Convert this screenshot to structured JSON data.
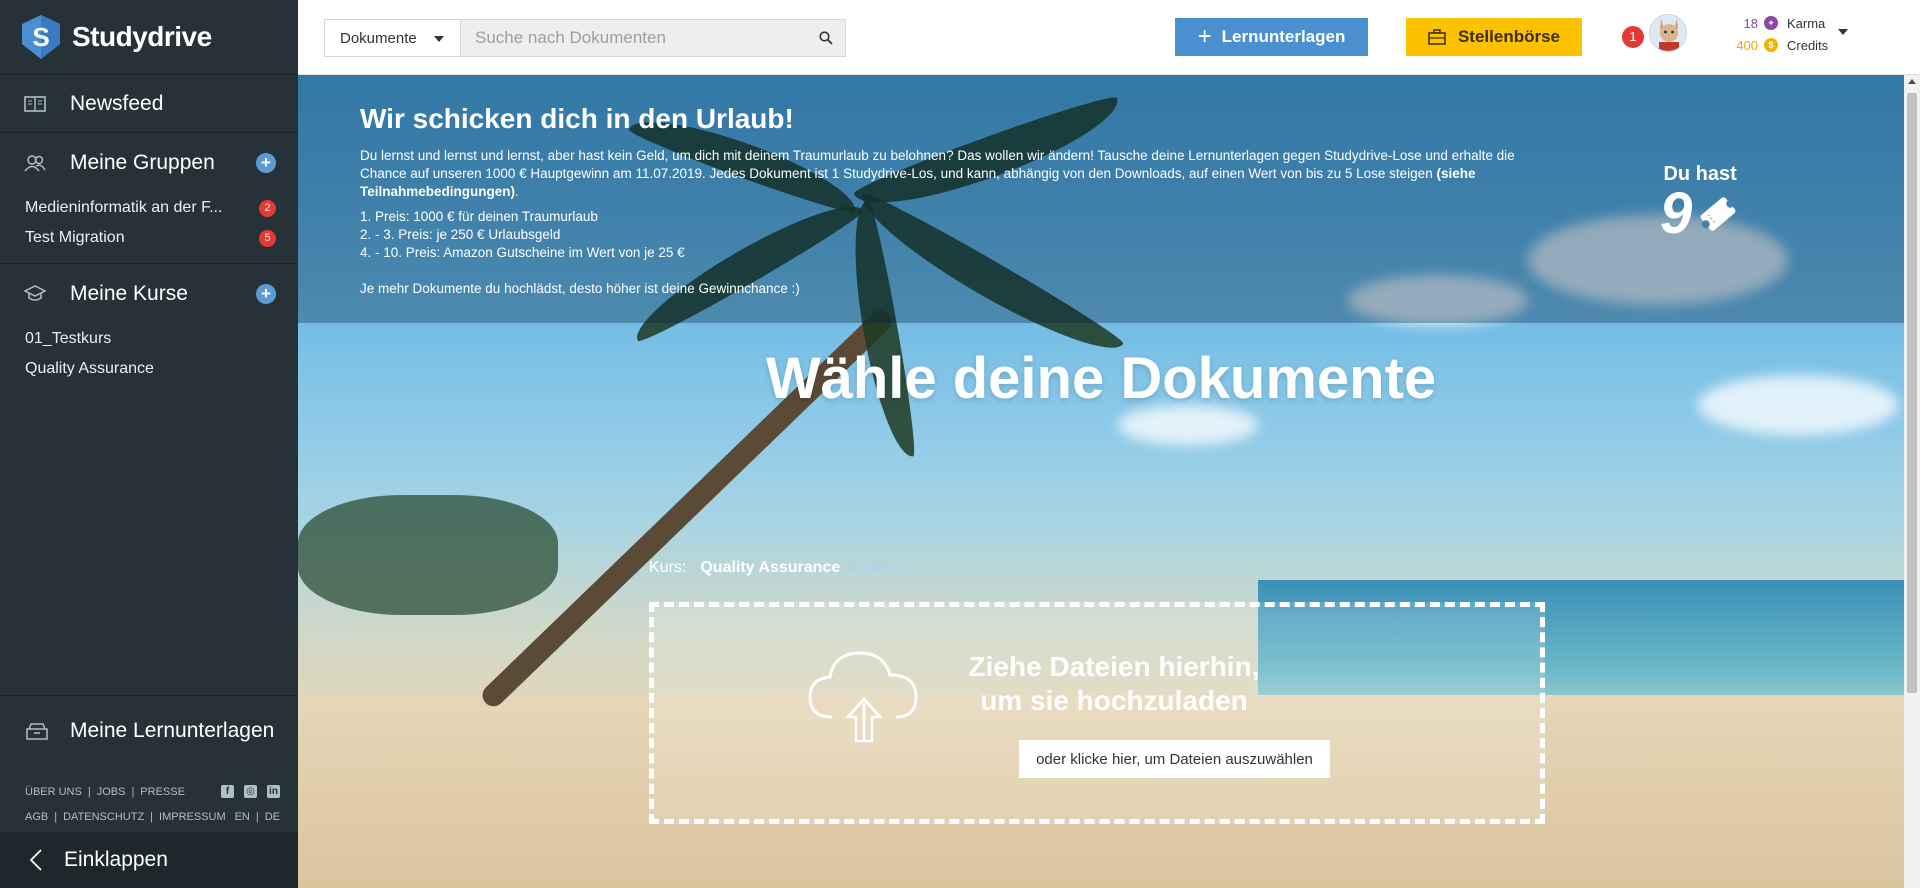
{
  "app": {
    "brand": "Studydrive"
  },
  "sidebar": {
    "newsfeed": "Newsfeed",
    "groups": {
      "label": "Meine Gruppen",
      "items": [
        {
          "label": "Medieninformatik an der F...",
          "badge": "2"
        },
        {
          "label": "Test Migration",
          "badge": "5"
        }
      ]
    },
    "courses": {
      "label": "Meine Kurse",
      "items": [
        {
          "label": "01_Testkurs"
        },
        {
          "label": "Quality Assurance"
        }
      ]
    },
    "my_materials": "Meine Lernunterlagen",
    "footer": {
      "row1": [
        "ÜBER UNS",
        "JOBS",
        "PRESSE"
      ],
      "row2": [
        "AGB",
        "DATENSCHUTZ",
        "IMPRESSUM"
      ],
      "langs": [
        "EN",
        "DE"
      ]
    },
    "collapse": "Einklappen"
  },
  "topbar": {
    "search_scope": "Dokumente",
    "search_placeholder": "Suche nach Dokumenten",
    "btn_materials": "Lernunterlagen",
    "btn_jobs": "Stellenbörse",
    "notifications": "1",
    "karma": {
      "value": "18",
      "label": "Karma"
    },
    "credits": {
      "value": "400",
      "label": "Credits"
    }
  },
  "promo": {
    "title": "Wir schicken dich in den Urlaub!",
    "text": "Du lernst und lernst und lernst, aber hast kein Geld, um dich mit deinem Traumurlaub zu belohnen? Das wollen wir ändern! Tausche deine Lernunterlagen gegen Studydrive-Lose und erhalte die Chance auf unseren 1000 € Hauptgewinn am 11.07.2019. Jedes Dokument ist 1 Studydrive-Los, und kann, abhängig von den Downloads, auf einen Wert von bis zu 5 Lose steigen",
    "terms_link": "(siehe Teilnahmebedingungen)",
    "prizes": [
      "1. Preis: 1000 € für deinen Traumurlaub",
      "2. - 3. Preis: je 250 € Urlaubsgeld",
      "4. - 10. Preis: Amazon Gutscheine im Wert von je 25 €"
    ],
    "footer": "Je mehr Dokumente du hochlädst, desto höher ist deine Gewinnchance :)",
    "tickets_label": "Du hast",
    "tickets_count": "9"
  },
  "upload": {
    "headline": "Wähle deine Dokumente",
    "course_label": "Kurs:",
    "course_value": "Quality Assurance",
    "course_change": "ändern",
    "drop_title": "Ziehe Dateien hierhin, um sie hochzuladen",
    "select_button": "oder klicke hier, um Dateien auszuwählen"
  },
  "colors": {
    "sidebar": "#263238",
    "primary": "#4a90d0",
    "jobs": "#fcc200",
    "badge": "#e53935"
  }
}
